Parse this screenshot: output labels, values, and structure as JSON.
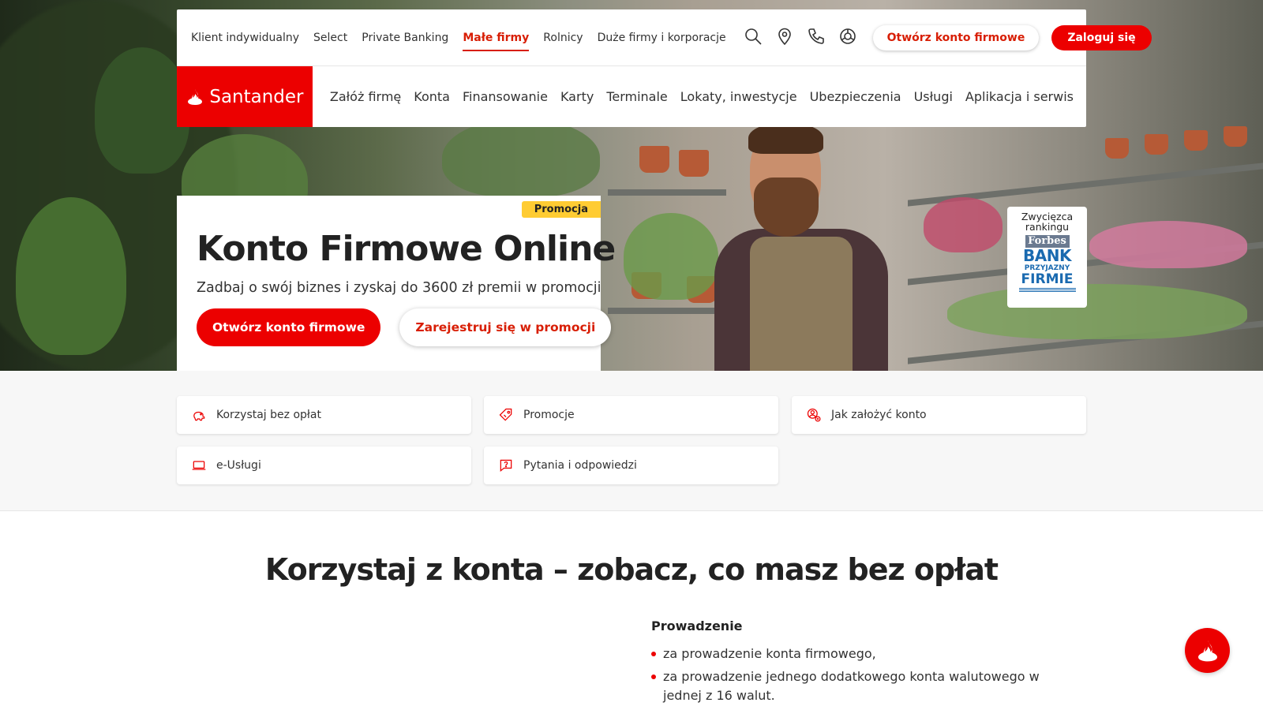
{
  "topbar": {
    "segments": [
      {
        "label": "Klient indywidualny"
      },
      {
        "label": "Select"
      },
      {
        "label": "Private Banking"
      },
      {
        "label": "Małe firmy"
      },
      {
        "label": "Rolnicy"
      },
      {
        "label": "Duże firmy i korporacje"
      }
    ],
    "active_segment": "Małe firmy",
    "icons": [
      "search-icon",
      "location-pin-icon",
      "phone-icon",
      "help-lifebuoy-icon"
    ],
    "open_account_label": "Otwórz konto firmowe",
    "login_label": "Zaloguj się"
  },
  "brand": {
    "name": "Santander",
    "color": "#ec0000"
  },
  "mainnav": {
    "items": [
      {
        "label": "Załóż firmę"
      },
      {
        "label": "Konta"
      },
      {
        "label": "Finansowanie"
      },
      {
        "label": "Karty"
      },
      {
        "label": "Terminale"
      },
      {
        "label": "Lokaty, inwestycje"
      },
      {
        "label": "Ubezpieczenia"
      },
      {
        "label": "Usługi"
      },
      {
        "label": "Aplikacja i serwis"
      }
    ]
  },
  "promo": {
    "badge": "Promocja",
    "title": "Konto Firmowe Online",
    "subtitle": "Zadbaj o swój biznes i zyskaj do 3600 zł premii w promocji",
    "primary_button": "Otwórz konto firmowe",
    "secondary_button": "Zarejestruj się w promocji"
  },
  "award": {
    "caption": "Zwycięzca rankingu",
    "logo_text": "Forbes",
    "line1": "BANK",
    "line2": "PRZYJAZNY",
    "line3": "FIRMIE"
  },
  "quick_links": [
    {
      "label": "Korzystaj bez opłat",
      "icon": "piggy-bank-icon"
    },
    {
      "label": "Promocje",
      "icon": "price-tag-icon"
    },
    {
      "label": "Jak założyć konto",
      "icon": "account-setup-icon"
    },
    {
      "label": "e-Usługi",
      "icon": "laptop-icon"
    },
    {
      "label": "Pytania i odpowiedzi",
      "icon": "question-bubble-icon"
    }
  ],
  "section": {
    "title": "Korzystaj z konta – zobacz, co masz bez opłat",
    "features_heading": "Prowadzenie",
    "features": [
      "za prowadzenie konta firmowego,",
      "za prowadzenie jednego dodatkowego konta walutowego w jednej z 16 walut."
    ]
  },
  "chat": {
    "icon": "santander-flame-icon"
  }
}
